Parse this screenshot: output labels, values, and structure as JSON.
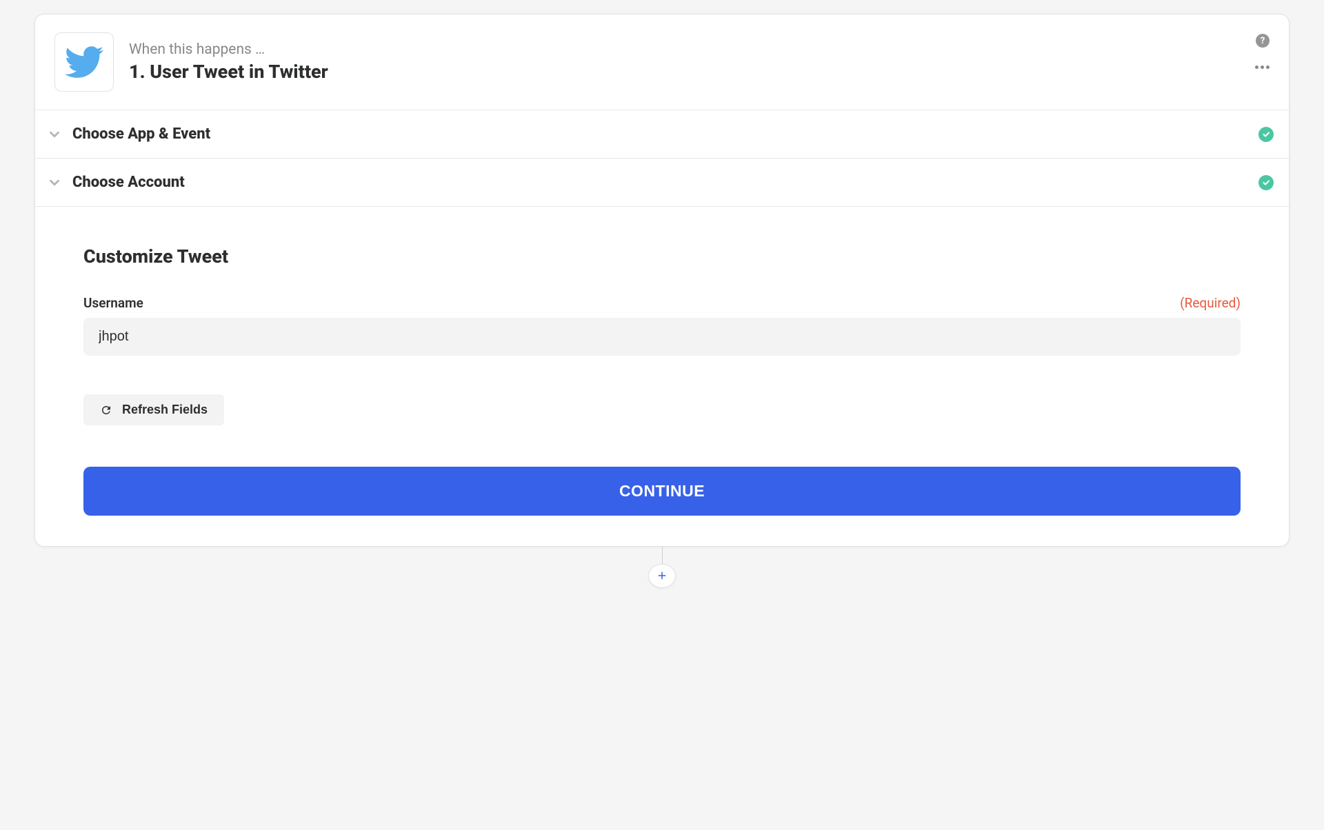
{
  "header": {
    "subtitle": "When this happens …",
    "title": "1. User Tweet in Twitter"
  },
  "sections": {
    "appEvent": "Choose App & Event",
    "account": "Choose Account"
  },
  "customize": {
    "title": "Customize Tweet",
    "fieldLabel": "Username",
    "requiredLabel": "(Required)",
    "usernameValue": "jhpot",
    "refreshLabel": "Refresh Fields",
    "continueLabel": "CONTINUE"
  },
  "icons": {
    "help": "?"
  }
}
